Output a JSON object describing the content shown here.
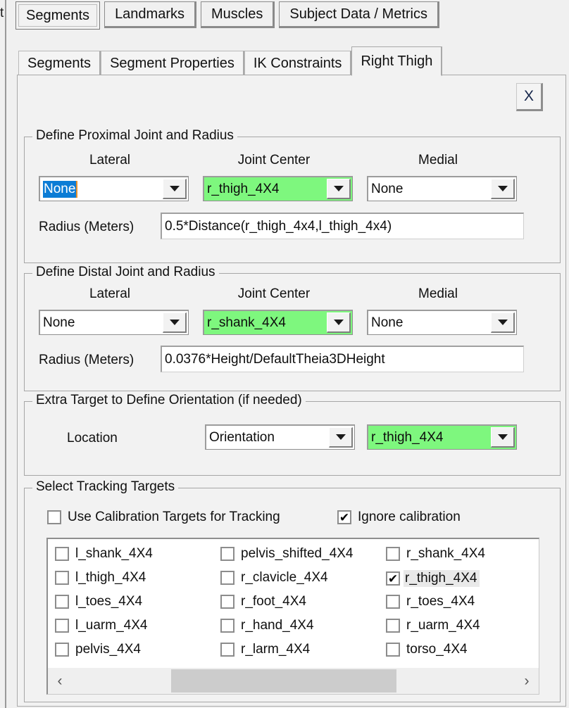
{
  "window": {
    "edge_fragment": "t"
  },
  "top_tabs": [
    {
      "label": "Segments",
      "selected": true
    },
    {
      "label": "Landmarks",
      "selected": false
    },
    {
      "label": "Muscles",
      "selected": false
    },
    {
      "label": "Subject Data / Metrics",
      "selected": false
    }
  ],
  "sub_tabs": [
    {
      "label": "Segments",
      "selected": false
    },
    {
      "label": "Segment Properties",
      "selected": false
    },
    {
      "label": "IK Constraints",
      "selected": false
    },
    {
      "label": "Right Thigh",
      "selected": true
    }
  ],
  "close_button": {
    "label": "X"
  },
  "proximal": {
    "group_label": "Define Proximal Joint and Radius",
    "headers": {
      "lateral": "Lateral",
      "joint_center": "Joint Center",
      "medial": "Medial"
    },
    "lateral_value": "None",
    "joint_center_value": "r_thigh_4X4",
    "medial_value": "None",
    "radius_label": "Radius (Meters)",
    "radius_value": "0.5*Distance(r_thigh_4x4,l_thigh_4x4)"
  },
  "distal": {
    "group_label": "Define Distal Joint and Radius",
    "headers": {
      "lateral": "Lateral",
      "joint_center": "Joint Center",
      "medial": "Medial"
    },
    "lateral_value": "None",
    "joint_center_value": "r_shank_4X4",
    "medial_value": "None",
    "radius_label": "Radius (Meters)",
    "radius_value": "0.0376*Height/DefaultTheia3DHeight"
  },
  "orientation": {
    "group_label": "Extra Target to Define Orientation (if needed)",
    "location_label": "Location",
    "location_value": "Orientation",
    "target_value": "r_thigh_4X4"
  },
  "tracking": {
    "group_label": "Select Tracking Targets",
    "use_calibration_label": "Use Calibration Targets for Tracking",
    "use_calibration_checked": false,
    "ignore_calibration_label": "Ignore calibration",
    "ignore_calibration_checked": true,
    "columns": [
      [
        {
          "label": "l_shank_4X4",
          "checked": false,
          "highlighted": false
        },
        {
          "label": "l_thigh_4X4",
          "checked": false,
          "highlighted": false
        },
        {
          "label": "l_toes_4X4",
          "checked": false,
          "highlighted": false
        },
        {
          "label": "l_uarm_4X4",
          "checked": false,
          "highlighted": false
        },
        {
          "label": "pelvis_4X4",
          "checked": false,
          "highlighted": false
        }
      ],
      [
        {
          "label": "pelvis_shifted_4X4",
          "checked": false,
          "highlighted": false
        },
        {
          "label": "r_clavicle_4X4",
          "checked": false,
          "highlighted": false
        },
        {
          "label": "r_foot_4X4",
          "checked": false,
          "highlighted": false
        },
        {
          "label": "r_hand_4X4",
          "checked": false,
          "highlighted": false
        },
        {
          "label": "r_larm_4X4",
          "checked": false,
          "highlighted": false
        }
      ],
      [
        {
          "label": "r_shank_4X4",
          "checked": false,
          "highlighted": false
        },
        {
          "label": "r_thigh_4X4",
          "checked": true,
          "highlighted": true
        },
        {
          "label": "r_toes_4X4",
          "checked": false,
          "highlighted": false
        },
        {
          "label": "r_uarm_4X4",
          "checked": false,
          "highlighted": false
        },
        {
          "label": "torso_4X4",
          "checked": false,
          "highlighted": false
        }
      ]
    ],
    "scroll_left_icon": "‹",
    "scroll_right_icon": "›"
  },
  "colors": {
    "selected_target_green": "#7ef77e",
    "text_selection_blue": "#0c7cd5",
    "panel_background": "#f2f2f2"
  },
  "glyphs": {
    "check": "✔"
  }
}
